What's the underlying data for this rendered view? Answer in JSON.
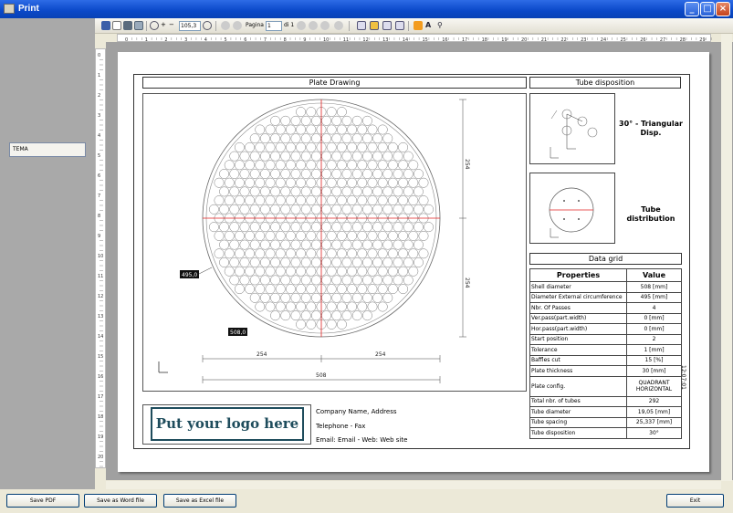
{
  "window": {
    "title": "Print"
  },
  "left": {
    "tema_button": "TEMA"
  },
  "toolbar": {
    "zoom": "105,3",
    "page_label": "Pagina",
    "page_value": "1",
    "page_total": "di 1"
  },
  "ruler": {
    "h_max": 29
  },
  "page": {
    "plate_drawing_title": "Plate Drawing",
    "tube_disposition_title": "Tube disposition",
    "triangular_label": "30° - Triangular Disp.",
    "tube_distribution_label": "Tube distribution",
    "data_grid_title": "Data grid",
    "dim_left": "495,0",
    "dim_bottom": "508,0",
    "dim_right_upper": "254",
    "dim_right_lower": "254",
    "dim_h_left": "254",
    "dim_h_right": "254",
    "dim_h_total": "508",
    "side_note": "12:07:01",
    "grid": {
      "header": [
        "Properties",
        "Value"
      ],
      "rows": [
        [
          "Shell diameter",
          "508 [mm]"
        ],
        [
          "Diameter External circumference",
          "495 [mm]"
        ],
        [
          "Nbr. Of Passes",
          "4"
        ],
        [
          "Ver.pass(part.width)",
          "0 [mm]"
        ],
        [
          "Hor.pass(part.width)",
          "0 [mm]"
        ],
        [
          "Start position",
          "2"
        ],
        [
          "Tolerance",
          "1 [mm]"
        ],
        [
          "Baffles cut",
          "15 [%]"
        ],
        [
          "Plate thickness",
          "30 [mm]"
        ],
        [
          "Plate config.",
          "QUADRANT HORIZONTAL"
        ],
        [
          "Total nbr. of tubes",
          "292"
        ],
        [
          "Tube diameter",
          "19,05 [mm]"
        ],
        [
          "Tube spacing",
          "25,337 [mm]"
        ],
        [
          "Tube disposition",
          "30°"
        ]
      ]
    },
    "logo_text": "Put your logo here",
    "company": "Company Name, Address",
    "phone": "Telephone - Fax",
    "email": "Email: Email - Web: Web site"
  },
  "bottom": {
    "save_pdf": "Save PDF",
    "save_word": "Save as Word file",
    "save_excel": "Save as Excel file",
    "exit": "Exit"
  }
}
